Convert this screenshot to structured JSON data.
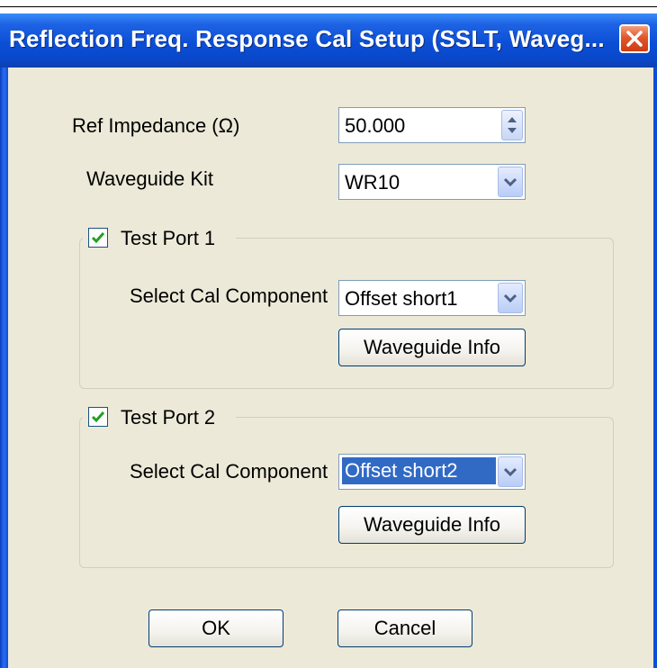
{
  "window": {
    "title": "Reflection Freq. Response Cal Setup (SSLT, Waveg..."
  },
  "ref_impedance": {
    "label": "Ref Impedance (Ω)",
    "value": "50.000"
  },
  "waveguide_kit": {
    "label": "Waveguide Kit",
    "value": "WR10"
  },
  "test_port_1": {
    "label": "Test Port 1",
    "checked": true,
    "component_label": "Select Cal Component",
    "component_value": "Offset short1",
    "info_button": "Waveguide Info"
  },
  "test_port_2": {
    "label": "Test Port 2",
    "checked": true,
    "component_label": "Select Cal Component",
    "component_value": "Offset short2",
    "info_button": "Waveguide Info"
  },
  "buttons": {
    "ok": "OK",
    "cancel": "Cancel"
  },
  "colors": {
    "titlebar": "#0b4fd6",
    "client": "#ece9d8",
    "selection": "#316ac5",
    "close": "#e2562b"
  }
}
